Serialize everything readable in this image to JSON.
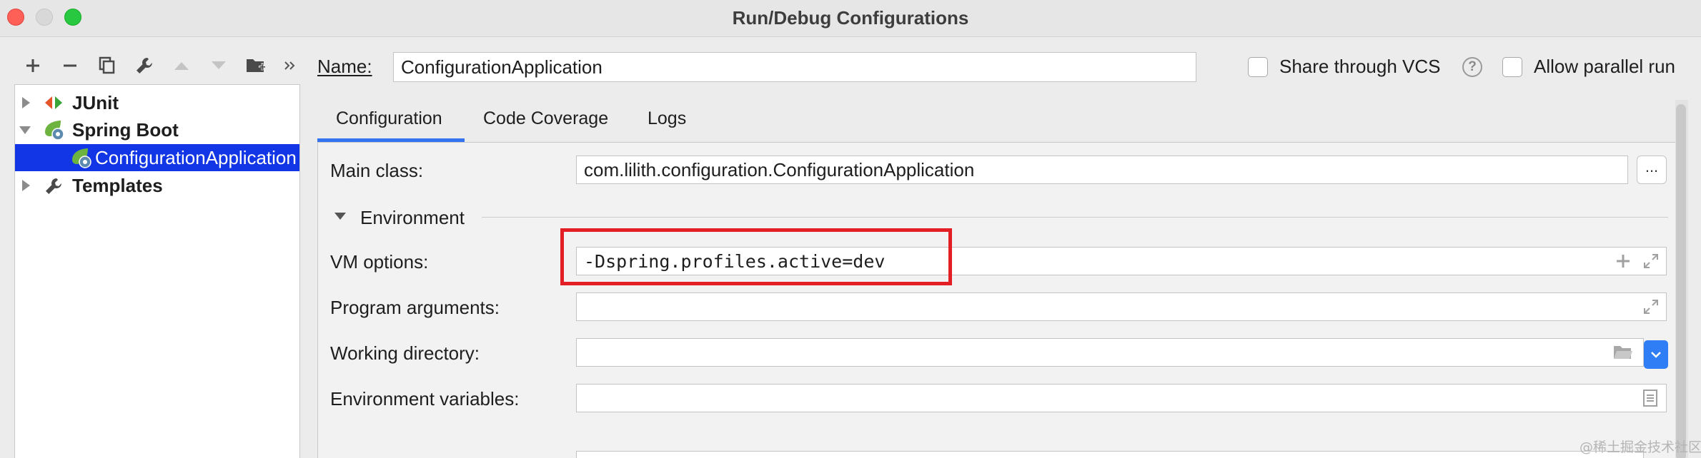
{
  "window": {
    "title": "Run/Debug Configurations"
  },
  "tree": {
    "items": [
      {
        "label": "JUnit",
        "icon": "junit-icon"
      },
      {
        "label": "Spring Boot",
        "icon": "spring-boot-icon"
      },
      {
        "label": "ConfigurationApplication",
        "icon": "spring-boot-config-icon"
      },
      {
        "label": "Templates",
        "icon": "wrench-icon"
      }
    ]
  },
  "header": {
    "name_label": "Name:",
    "name_value": "ConfigurationApplication",
    "share_vcs_label": "Share through VCS",
    "allow_parallel_label": "Allow parallel run"
  },
  "tabs": [
    {
      "label": "Configuration"
    },
    {
      "label": "Code Coverage"
    },
    {
      "label": "Logs"
    }
  ],
  "form": {
    "main_class_label": "Main class:",
    "main_class_value": "com.lilith.configuration.ConfigurationApplication",
    "browse_label": "...",
    "environment_section": "Environment",
    "vm_options_label": "VM options:",
    "vm_options_value": "-Dspring.profiles.active=dev",
    "program_args_label": "Program arguments:",
    "working_dir_label": "Working directory:",
    "env_vars_label": "Environment variables:"
  },
  "watermark": "@稀土掘金技术社区",
  "colors": {
    "selection": "#1236e6",
    "accent": "#3574f0",
    "highlight_box": "#e31e24"
  }
}
